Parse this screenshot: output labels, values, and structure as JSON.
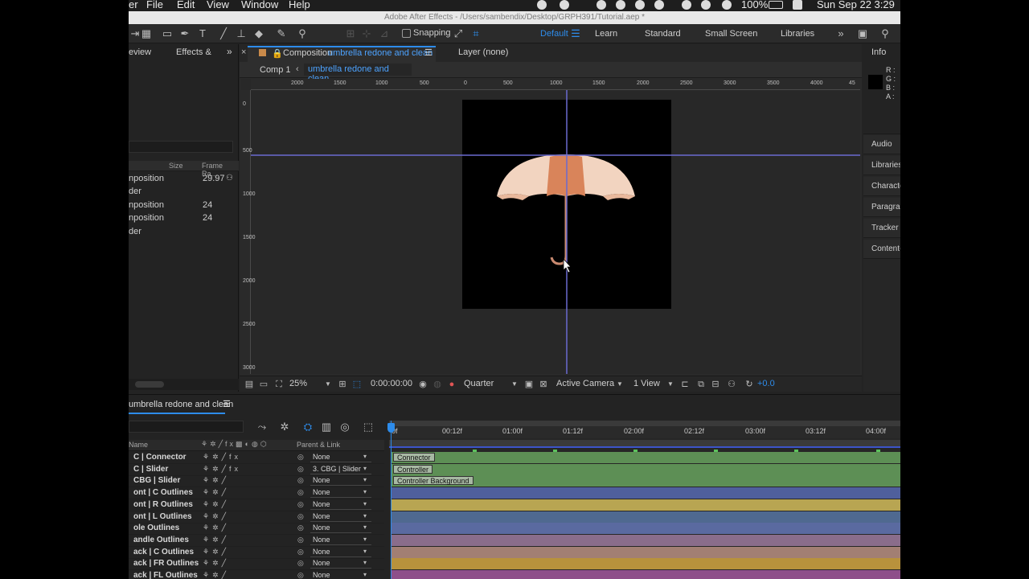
{
  "menubar": {
    "app_fragment": "er",
    "menus": [
      "File",
      "Edit",
      "View",
      "Window",
      "Help"
    ],
    "battery": "100%",
    "datetime": "Sun Sep 22  3:29"
  },
  "titlebar": {
    "title": "Adobe After Effects - /Users/sambendix/Desktop/GRPH391/Tutorial.aep *"
  },
  "toolbar": {
    "snapping_label": "Snapping",
    "workspaces": [
      "Default",
      "Learn",
      "Standard",
      "Small Screen",
      "Libraries"
    ],
    "active_workspace": "Default"
  },
  "project_panel": {
    "tabs": [
      "eview",
      "Effects &"
    ],
    "columns": {
      "size": "Size",
      "frame_rate": "Frame Ra..."
    },
    "rows": [
      {
        "name": "nposition",
        "rate": "29.97"
      },
      {
        "name": "der",
        "rate": ""
      },
      {
        "name": "nposition",
        "rate": "24"
      },
      {
        "name": "nposition",
        "rate": "24"
      },
      {
        "name": "der",
        "rate": ""
      }
    ]
  },
  "composition": {
    "tab_prefix": "Composition",
    "tab_name": "umbrella redone and clean",
    "layer_tab": "Layer (none)",
    "breadcrumbs": [
      "Comp 1",
      "umbrella redone and clean"
    ],
    "ruler_top": [
      "2000",
      "1500",
      "1000",
      "500",
      "0",
      "500",
      "1000",
      "1500",
      "2000",
      "2500",
      "3000",
      "3500",
      "4000",
      "45"
    ],
    "ruler_left": [
      "0",
      "500",
      "1000",
      "1500",
      "2000",
      "2500",
      "3000"
    ],
    "footer": {
      "zoom": "25%",
      "timecode": "0:00:00:00",
      "resolution": "Quarter",
      "camera": "Active Camera",
      "views": "1 View",
      "exposure": "+0.0"
    }
  },
  "right_panel": {
    "info_title": "Info",
    "info_labels": [
      "R :",
      "G :",
      "B :",
      "A :"
    ],
    "items": [
      "Audio",
      "Libraries",
      "Character",
      "Paragraph",
      "Tracker",
      "Content-Aware Fill"
    ]
  },
  "timeline": {
    "tab": "umbrella redone and clean",
    "col_name": "Name",
    "col_parent": "Parent & Link",
    "time_labels": [
      "0f",
      "00:12f",
      "01:00f",
      "01:12f",
      "02:00f",
      "02:12f",
      "03:00f",
      "03:12f",
      "04:00f"
    ],
    "layers": [
      {
        "name": "C | Connector",
        "parent": "None",
        "fx": true,
        "bar_label": "Connector",
        "color": "#5d8f55"
      },
      {
        "name": "C | Slider",
        "parent": "3. CBG | Slider",
        "fx": true,
        "bar_label": "Controller",
        "color": "#5d8f55"
      },
      {
        "name": "CBG | Slider",
        "parent": "None",
        "fx": false,
        "bar_label": "Controller Background",
        "color": "#5d8f55"
      },
      {
        "name": "ont | C Outlines",
        "parent": "None",
        "fx": false,
        "bar_label": "",
        "color": "#4f5f9c"
      },
      {
        "name": "ont | R Outlines",
        "parent": "None",
        "fx": false,
        "bar_label": "",
        "color": "#b8a552"
      },
      {
        "name": "ont | L Outlines",
        "parent": "None",
        "fx": false,
        "bar_label": "",
        "color": "#4f6990"
      },
      {
        "name": "ole Outlines",
        "parent": "None",
        "fx": false,
        "bar_label": "",
        "color": "#5a6aa0"
      },
      {
        "name": "andle Outlines",
        "parent": "None",
        "fx": false,
        "bar_label": "",
        "color": "#8a6d8b"
      },
      {
        "name": "ack | C Outlines",
        "parent": "None",
        "fx": false,
        "bar_label": "",
        "color": "#a27f73"
      },
      {
        "name": "ack | FR Outlines",
        "parent": "None",
        "fx": false,
        "bar_label": "",
        "color": "#b8923c"
      },
      {
        "name": "ack | FL Outlines",
        "parent": "None",
        "fx": false,
        "bar_label": "",
        "color": "#8e4f8a"
      }
    ]
  },
  "colors": {
    "accent": "#2d8ceb",
    "umbrella_light": "#f2d4c0",
    "umbrella_orange": "#d9845a",
    "guide_line": "#6a6ad0"
  }
}
